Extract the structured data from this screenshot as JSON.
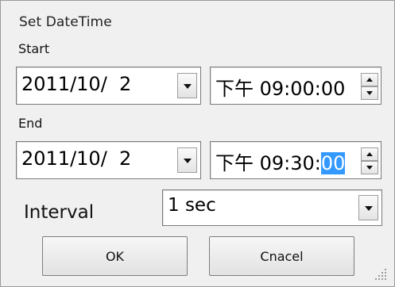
{
  "dialog": {
    "title": "Set DateTime"
  },
  "start": {
    "label": "Start",
    "date": "2011/10/  2",
    "time_prefix": "下午 ",
    "time_value": "09:00:00"
  },
  "end": {
    "label": "End",
    "date": "2011/10/  2",
    "time_prefix": "下午 ",
    "time_hm": "09:30:",
    "time_selected_seconds": "00"
  },
  "interval": {
    "label": "Interval",
    "selected": "1 sec"
  },
  "buttons": {
    "ok": "OK",
    "cancel": "Cnacel"
  },
  "icons": {
    "dropdown": "chevron-down-icon",
    "spin_up": "spin-up-icon",
    "spin_down": "spin-down-icon",
    "resize": "resize-grip-icon"
  },
  "colors": {
    "selection": "#3399ff",
    "dialog_bg": "#f0f0f0"
  }
}
